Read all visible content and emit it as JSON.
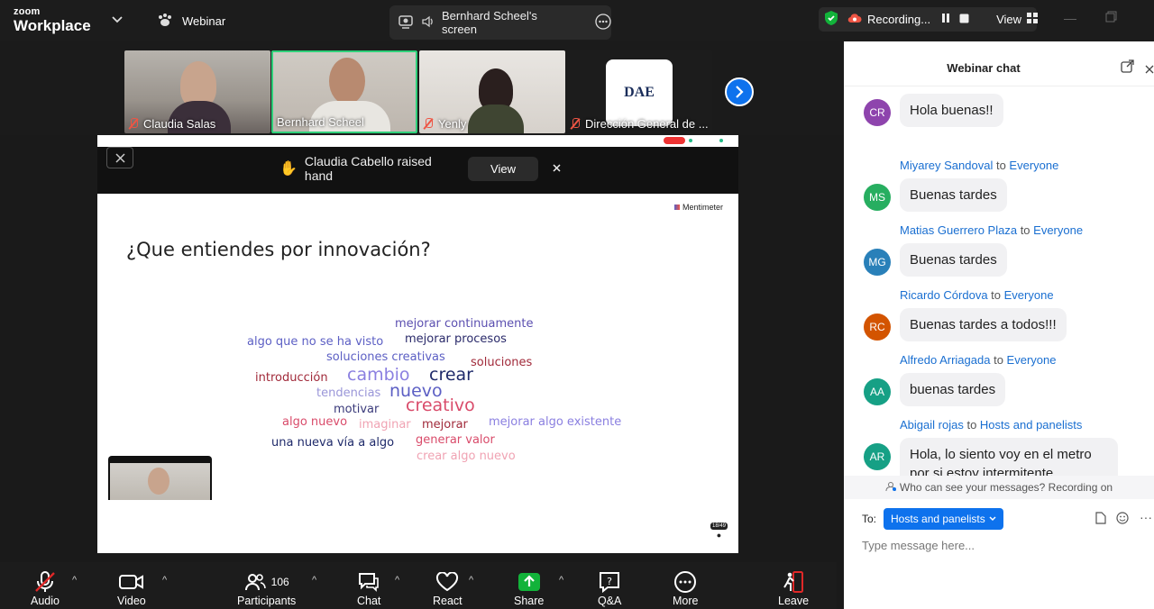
{
  "app": {
    "brand_top": "zoom",
    "brand_bottom": "Workplace",
    "webinar_label": "Webinar"
  },
  "share": {
    "label": "Bernhard Scheel's screen"
  },
  "recording": {
    "label": "Recording...",
    "view_label": "View"
  },
  "participants_strip": [
    {
      "name": "Claudia Salas",
      "muted": true
    },
    {
      "name": "Bernhard Scheel",
      "muted": false
    },
    {
      "name": "Yenly",
      "muted": true
    },
    {
      "name": "Dirección General de ...",
      "muted": true,
      "logo": "DAE"
    }
  ],
  "notification": {
    "text": "Claudia Cabello raised hand",
    "view_label": "View"
  },
  "slide": {
    "brand": "Mentimeter",
    "question": "¿Que entiendes por innovación?",
    "counter": "18/49",
    "words": [
      {
        "text": "mejorar continuamente",
        "color": "#5b4fb0"
      },
      {
        "text": "algo que no se ha visto",
        "color": "#5c5fc4"
      },
      {
        "text": "mejorar procesos",
        "color": "#2a2a6a"
      },
      {
        "text": "soluciones creativas",
        "color": "#5c5fc4"
      },
      {
        "text": "soluciones",
        "color": "#a12a3a"
      },
      {
        "text": "introducción",
        "color": "#a12a3a"
      },
      {
        "text": "cambio",
        "color": "#8a7fe0"
      },
      {
        "text": "crear",
        "color": "#1f2a6a"
      },
      {
        "text": "tendencias",
        "color": "#9a96d8"
      },
      {
        "text": "nuevo",
        "color": "#5c5fc4"
      },
      {
        "text": "motivar",
        "color": "#3a3a7a"
      },
      {
        "text": "creativo",
        "color": "#d94b6a"
      },
      {
        "text": "algo nuevo",
        "color": "#d94b6a"
      },
      {
        "text": "imaginar",
        "color": "#f0a3b3"
      },
      {
        "text": "mejorar",
        "color": "#a12a3a"
      },
      {
        "text": "mejorar algo existente",
        "color": "#8a7fe0"
      },
      {
        "text": "una nueva vía a algo",
        "color": "#1f2a6a"
      },
      {
        "text": "generar valor",
        "color": "#d94b6a"
      },
      {
        "text": "crear algo nuevo",
        "color": "#f0a3b3"
      }
    ]
  },
  "chat": {
    "title": "Webinar chat",
    "messages": [
      {
        "initials": "CR",
        "avatar_color": "#8e44ad",
        "sender": "",
        "to": "",
        "target": "",
        "text": "Hola buenas!!"
      },
      {
        "initials": "MS",
        "avatar_color": "#27ae60",
        "sender": "Miyarey Sandoval",
        "to": "to",
        "target": "Everyone",
        "text": "Buenas tardes"
      },
      {
        "initials": "MG",
        "avatar_color": "#2980b9",
        "sender": "Matias Guerrero Plaza",
        "to": "to",
        "target": "Everyone",
        "text": "Buenas tardes"
      },
      {
        "initials": "RC",
        "avatar_color": "#d35400",
        "sender": "Ricardo Córdova",
        "to": "to",
        "target": "Everyone",
        "text": "Buenas tardes a todos!!!"
      },
      {
        "initials": "AA",
        "avatar_color": "#16a085",
        "sender": "Alfredo Arriagada",
        "to": "to",
        "target": "Everyone",
        "text": "buenas tardes"
      },
      {
        "initials": "AR",
        "avatar_color": "#16a085",
        "sender": "Abigail rojas",
        "to": "to",
        "target": "Hosts and panelists",
        "text": "Hola, lo siento voy en el metro por si estoy intermitente"
      }
    ],
    "notice": "Who can see your messages? Recording on",
    "to_label": "To:",
    "to_value": "Hosts and panelists",
    "input_placeholder": "Type message here..."
  },
  "toolbar": {
    "audio": "Audio",
    "video": "Video",
    "participants": "Participants",
    "participants_count": "106",
    "chat": "Chat",
    "react": "React",
    "share": "Share",
    "qa": "Q&A",
    "more": "More",
    "leave": "Leave"
  },
  "colors": {
    "share_green": "#12b33a",
    "chat_link": "#1a6fd1",
    "to_button": "#0e72ed",
    "leave_red": "#e02828"
  }
}
